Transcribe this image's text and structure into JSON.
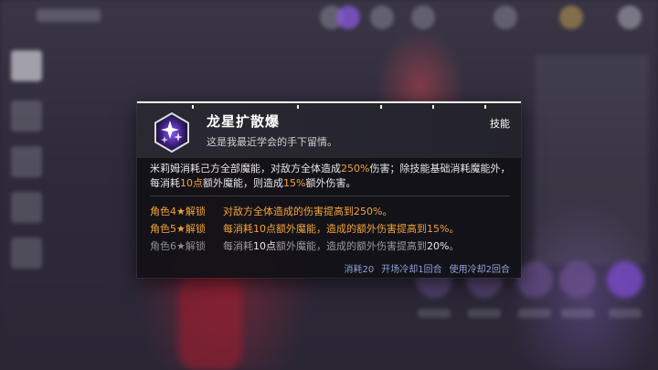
{
  "background": {
    "top_left_name": "",
    "accent_purple": "#7a4fd6",
    "accent_red": "#b02a3c"
  },
  "tooltip": {
    "skill_name": "龙星扩散爆",
    "skill_subtitle": "这是我最近学会的手下留情。",
    "skill_type": "技能",
    "icon": "purple-star-burst-icon",
    "description": {
      "p1": "米莉姆消耗己方全部魔能，对敌方全体造成",
      "p1_value": "250%",
      "p2": "伤害；除技能基础消耗魔能外，",
      "p3": "每消耗",
      "p3_value": "10点",
      "p4": "额外魔能，则造成",
      "p4_value": "15%",
      "p5": "额外伤害。"
    },
    "unlocks": [
      {
        "role": "角色4★解锁",
        "text_a": "对敌方全体造成的伤害提高到",
        "value_a": "250%",
        "text_b": "",
        "value_b": "",
        "text_c": "。",
        "active": true
      },
      {
        "role": "角色5★解锁",
        "text_a": "每消耗",
        "value_a": "10点",
        "text_b": "额外魔能，造成的额外伤害提高到",
        "value_b": "15%",
        "text_c": "。",
        "active": true
      },
      {
        "role": "角色6★解锁",
        "text_a": "每消耗",
        "value_a": "10点",
        "text_b": "额外魔能，造成的额外伤害提高到",
        "value_b": "20%",
        "text_c": "。",
        "active": false
      }
    ],
    "footer": {
      "cost": "消耗20",
      "opening_cooldown": "开场冷却1回合",
      "use_cooldown": "使用冷却2回合"
    },
    "colors": {
      "highlight": "#f2a33a",
      "footer": "#8fa3d9"
    }
  }
}
